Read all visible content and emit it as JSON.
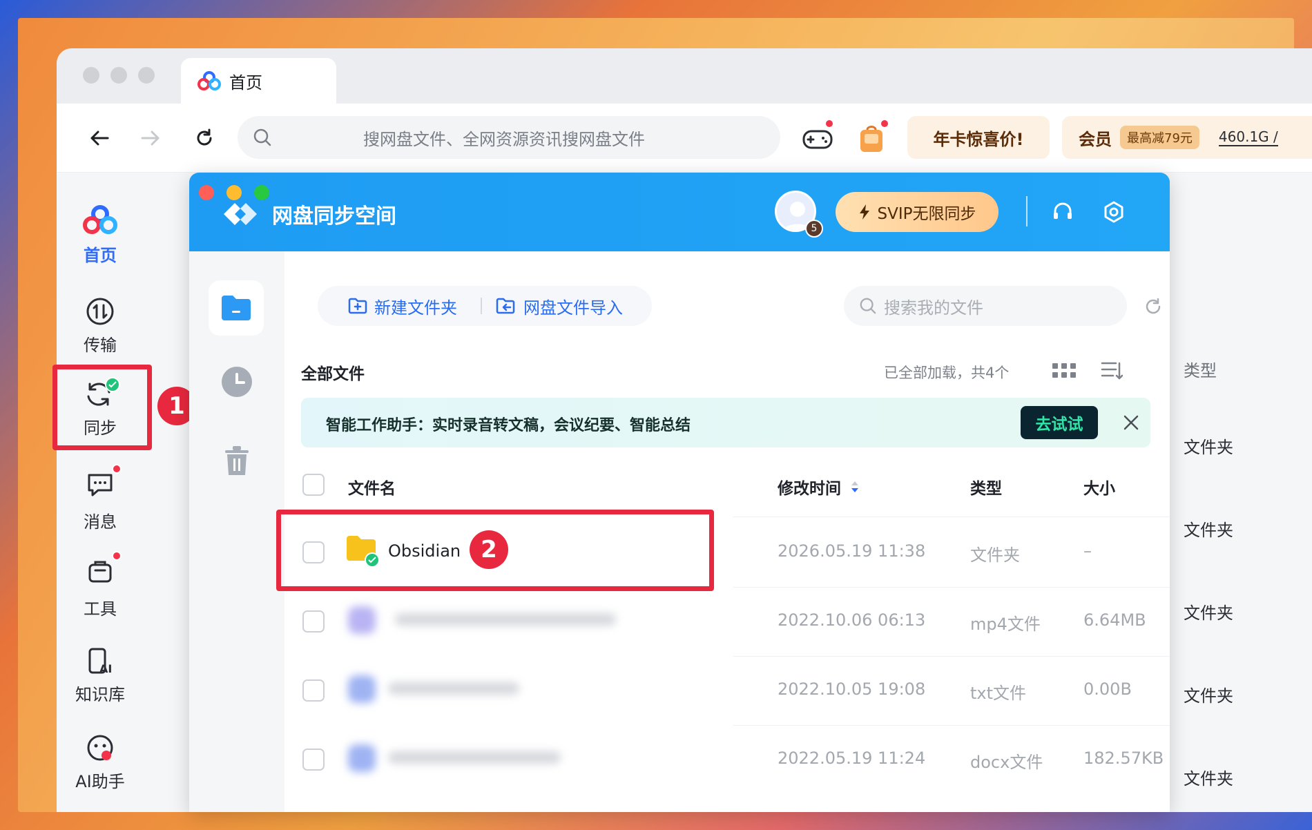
{
  "browser": {
    "tab_title": "首页",
    "search_placeholder": "搜网盘文件、全网资源资讯搜网盘文件",
    "promo_annual": "年卡惊喜价!",
    "promo_vip": "会员",
    "promo_vip_badge": "最高减79元",
    "storage": "460.1G /"
  },
  "sidebar": {
    "items": [
      {
        "label": "首页",
        "icon": "cloud-logo-icon"
      },
      {
        "label": "传输",
        "icon": "transfer-icon"
      },
      {
        "label": "同步",
        "icon": "sync-icon"
      },
      {
        "label": "消息",
        "icon": "message-icon"
      },
      {
        "label": "工具",
        "icon": "toolbox-icon"
      },
      {
        "label": "知识库",
        "icon": "knowledge-icon"
      },
      {
        "label": "AI助手",
        "icon": "ai-assistant-icon"
      }
    ]
  },
  "sync_window": {
    "title": "网盘同步空间",
    "avatar_level": "5",
    "svip_label": "SVIP无限同步",
    "new_folder": "新建文件夹",
    "import": "网盘文件导入",
    "search_placeholder": "搜索我的文件",
    "section_title": "全部文件",
    "load_status": "已全部加载，共4个",
    "banner_text": "智能工作助手：实时录音转文稿，会议纪要、智能总结",
    "banner_button": "去试试",
    "columns": {
      "name": "文件名",
      "modified": "修改时间",
      "type": "类型",
      "size": "大小"
    },
    "rows": [
      {
        "name": "Obsidian",
        "modified": "2026.05.19 11:38",
        "type": "文件夹",
        "size": "–"
      },
      {
        "name": "",
        "modified": "2022.10.06 06:13",
        "type": "mp4文件",
        "size": "6.64MB"
      },
      {
        "name": "",
        "modified": "2022.10.05 19:08",
        "type": "txt文件",
        "size": "0.00B"
      },
      {
        "name": "",
        "modified": "2022.05.19 11:24",
        "type": "docx文件",
        "size": "182.57KB"
      }
    ]
  },
  "right_column": {
    "header": "类型",
    "items": [
      "文件夹",
      "文件夹",
      "文件夹",
      "文件夹",
      "文件夹"
    ]
  },
  "annotations": {
    "one": "1",
    "two": "2"
  },
  "colors": {
    "accent": "#2f6bff",
    "sync_header": "#1e9cf3",
    "annotation": "#e8283e",
    "folder": "#f7c21b"
  }
}
